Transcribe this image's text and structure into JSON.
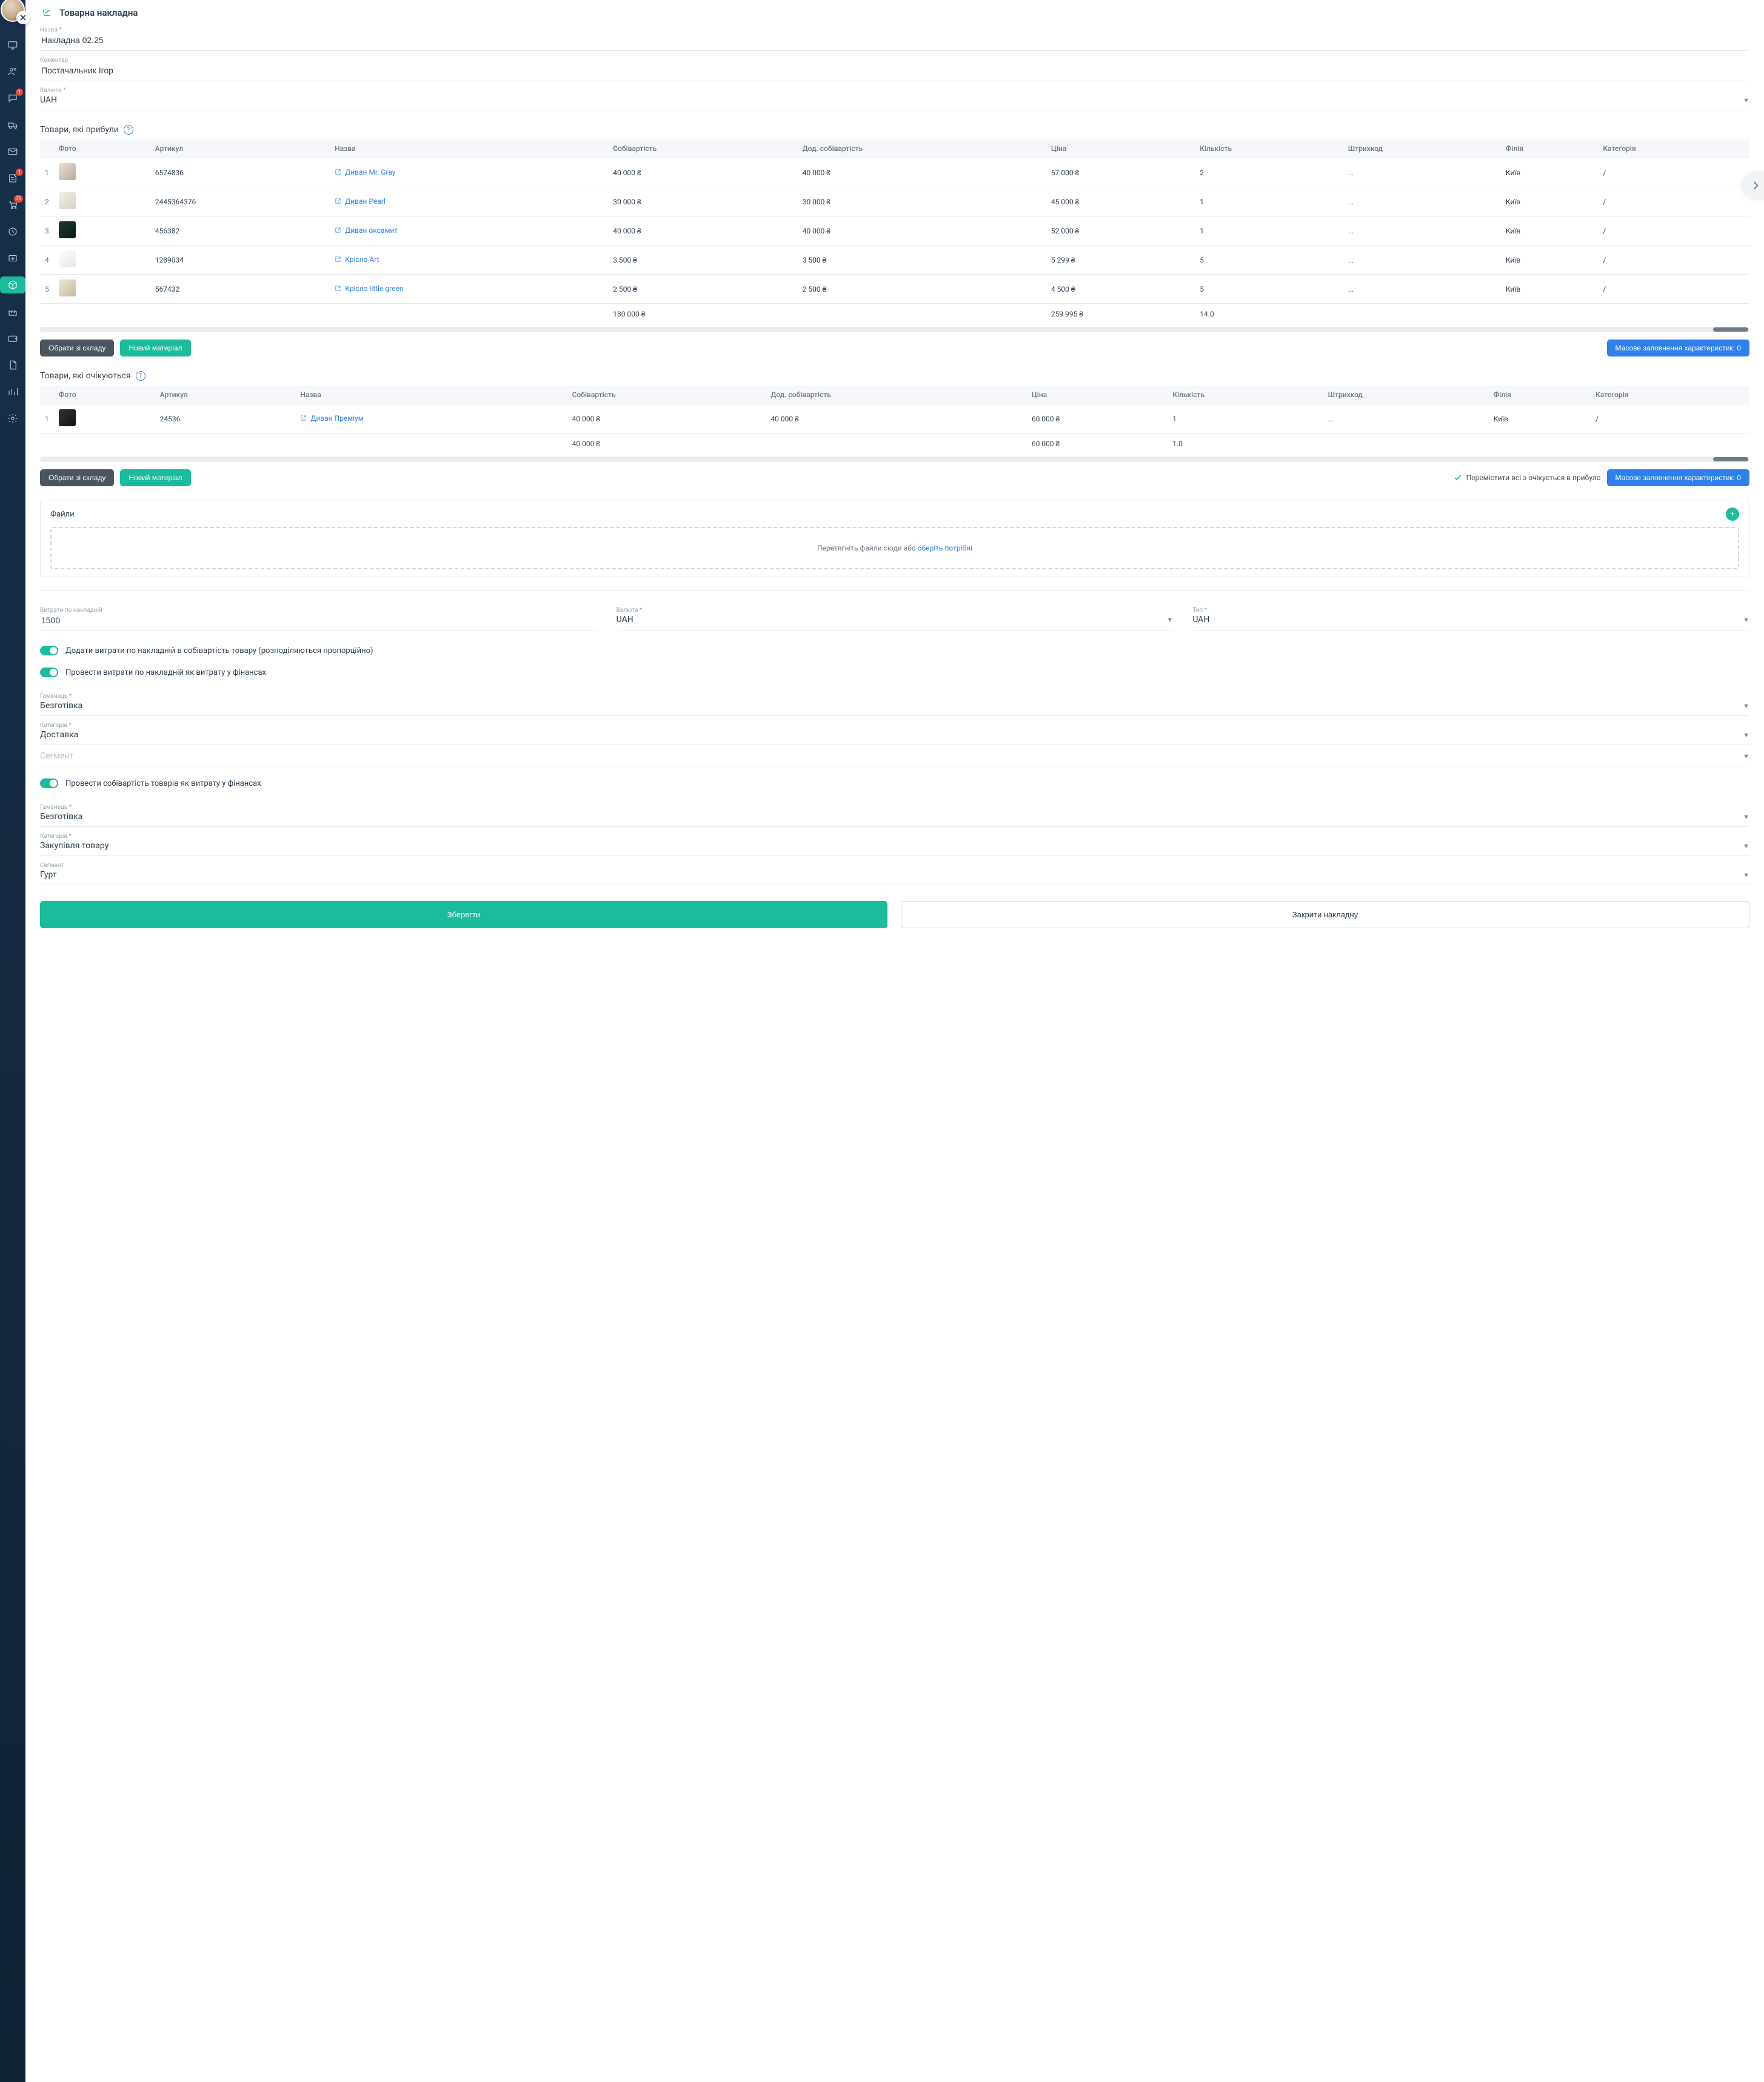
{
  "sidebar": {
    "badges": {
      "chat": "1",
      "notes": "1",
      "cart": "71"
    }
  },
  "header": {
    "title": "Товарна накладна"
  },
  "form": {
    "name_label": "Назва *",
    "name_value": "Накладна 02.25",
    "comment_label": "Коментар",
    "comment_value": "Постачальник Ігор",
    "currency_label": "Валюта *",
    "currency_value": "UAH"
  },
  "arrived": {
    "section_label": "Товари, які прибули",
    "columns": {
      "photo": "Фото",
      "sku": "Артикул",
      "name": "Назва",
      "cost": "Собівартість",
      "addcost": "Дод. собівартість",
      "price": "Ціна",
      "qty": "Кількість",
      "barcode": "Штрихкод",
      "branch": "Філія",
      "category": "Категорія"
    },
    "rows": [
      {
        "n": "1",
        "sku": "6574836",
        "name": "Диван Mr. Gray",
        "cost": "40 000 ₴",
        "addcost": "40 000 ₴",
        "price": "57 000 ₴",
        "qty": "2",
        "barcode": "...",
        "branch": "Київ",
        "cat": "/",
        "tclass": "t1"
      },
      {
        "n": "2",
        "sku": "2445364376",
        "name": "Диван Pearl",
        "cost": "30 000 ₴",
        "addcost": "30 000 ₴",
        "price": "45 000 ₴",
        "qty": "1",
        "barcode": "...",
        "branch": "Київ",
        "cat": "/",
        "tclass": "t2"
      },
      {
        "n": "3",
        "sku": "456382",
        "name": "Диван оксамит",
        "cost": "40 000 ₴",
        "addcost": "40 000 ₴",
        "price": "52 000 ₴",
        "qty": "1",
        "barcode": "...",
        "branch": "Київ",
        "cat": "/",
        "tclass": "t3"
      },
      {
        "n": "4",
        "sku": "1289034",
        "name": "Крісло Art",
        "cost": "3 500 ₴",
        "addcost": "3 500 ₴",
        "price": "5 299 ₴",
        "qty": "5",
        "barcode": "...",
        "branch": "Київ",
        "cat": "/",
        "tclass": "t4"
      },
      {
        "n": "5",
        "sku": "567432",
        "name": "Крісло little green",
        "cost": "2 500 ₴",
        "addcost": "2 500 ₴",
        "price": "4 500 ₴",
        "qty": "5",
        "barcode": "...",
        "branch": "Київ",
        "cat": "/",
        "tclass": "t5"
      }
    ],
    "totals": {
      "cost": "180 000 ₴",
      "price": "259 995 ₴",
      "qty": "14.0"
    },
    "buttons": {
      "from_stock": "Обрати зі складу",
      "new_material": "Новий матеріал",
      "mass_fill": "Масове заповнення характеристик: 0"
    }
  },
  "pending": {
    "section_label": "Товари, які очікуються",
    "columns": {
      "photo": "Фото",
      "sku": "Артикул",
      "name": "Назва",
      "cost": "Собівартість",
      "addcost": "Дод. собівартість",
      "price": "Ціна",
      "qty": "Кількість",
      "barcode": "Штрихкод",
      "branch": "Філія",
      "category": "Категорія"
    },
    "rows": [
      {
        "n": "1",
        "sku": "24536",
        "name": "Диван Преміум",
        "cost": "40 000 ₴",
        "addcost": "40 000 ₴",
        "price": "60 000 ₴",
        "qty": "1",
        "barcode": "...",
        "branch": "Київ",
        "cat": "/",
        "tclass": "t6"
      }
    ],
    "totals": {
      "cost": "40 000 ₴",
      "price": "60 000 ₴",
      "qty": "1.0"
    },
    "buttons": {
      "from_stock": "Обрати зі складу",
      "new_material": "Новий матеріал",
      "move_all": "Перемістити всі з очікується в прибуло",
      "mass_fill": "Масове заповнення характеристик: 0"
    }
  },
  "files": {
    "label": "Файли",
    "dropzone_text": "Перетягніть файли сюди або ",
    "dropzone_link": "оберіть потрібні"
  },
  "expenses": {
    "amount_label": "Витрати по накладній",
    "amount_value": "1500",
    "currency_label": "Валюта *",
    "currency_value": "UAH",
    "type_label": "Тип *",
    "type_value": "UAH"
  },
  "toggles": {
    "add_cost": "Додати витрати по накладній в собівартість товару (розподіляються пропорційно)",
    "finance_expense": "Провести витрати по накладній як витрату у фінансах",
    "finance_cost": "Провести собівартість товарів як витрату у фінансах"
  },
  "finance1": {
    "wallet_label": "Гаманець *",
    "wallet_value": "Безготівка",
    "category_label": "Категорія *",
    "category_value": "Доставка",
    "segment_label": "Сегмент",
    "segment_value": ""
  },
  "finance2": {
    "wallet_label": "Гаманець *",
    "wallet_value": "Безготівка",
    "category_label": "Категорія *",
    "category_value": "Закупівля товару",
    "segment_label": "Сегмент",
    "segment_value": "Гурт"
  },
  "footer": {
    "save": "Зберегти",
    "close": "Закрити накладну"
  }
}
